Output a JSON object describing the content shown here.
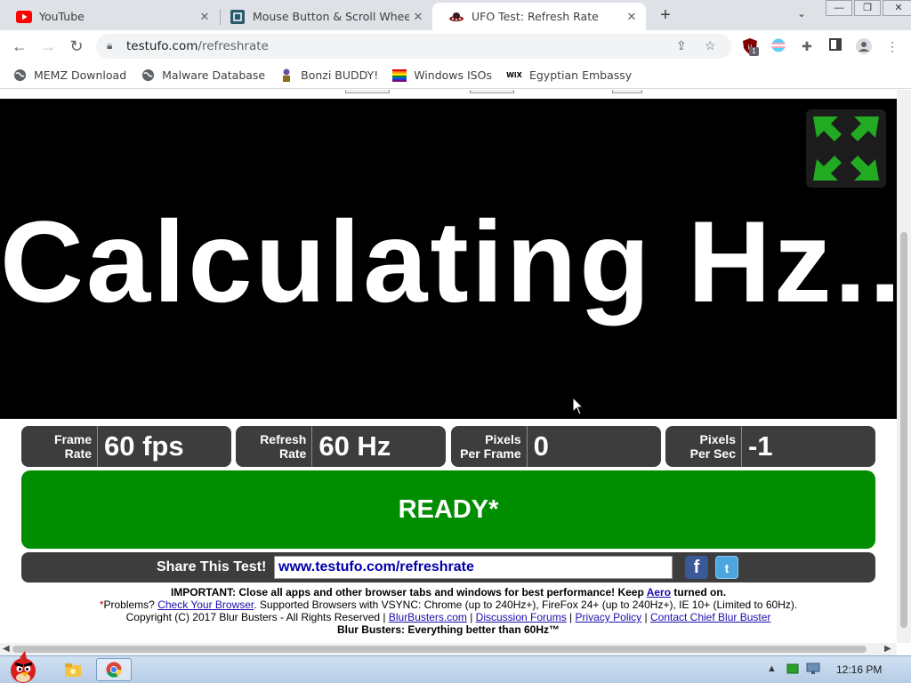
{
  "browser": {
    "tabs": [
      {
        "title": "YouTube",
        "close": "✕"
      },
      {
        "title": "Mouse Button & Scroll Wheel",
        "close": "✕"
      },
      {
        "title": "UFO Test: Refresh Rate",
        "close": "✕"
      }
    ],
    "new_tab": "+",
    "tab_search": "⌄",
    "window_controls": {
      "minimize": "—",
      "restore": "❐",
      "close": "✕"
    },
    "url_host": "testufo.com",
    "url_path": "/refreshrate",
    "extension_badge": "1",
    "bookmarks": [
      {
        "label": "MEMZ Download",
        "icon": "globe-icon"
      },
      {
        "label": "Malware Database",
        "icon": "globe-icon"
      },
      {
        "label": "Bonzi BUDDY!",
        "icon": "bonzi-icon"
      },
      {
        "label": "Windows ISOs",
        "icon": "rainbow-flag-icon"
      },
      {
        "label": "Egyptian Embassy",
        "icon": "wix-icon"
      }
    ],
    "wix_text": "WiX"
  },
  "page": {
    "stage_text": "Calculating Hz...",
    "stats": [
      {
        "label1": "Frame",
        "label2": "Rate",
        "value": "60 fps"
      },
      {
        "label1": "Refresh",
        "label2": "Rate",
        "value": "60 Hz"
      },
      {
        "label1": "Pixels",
        "label2": "Per Frame",
        "value": "0"
      },
      {
        "label1": "Pixels",
        "label2": "Per Sec",
        "value": "-1"
      }
    ],
    "ready": "READY*",
    "share_label": "Share This Test!",
    "share_url": "www.testufo.com/refreshrate",
    "facebook": "f",
    "twitter": "t",
    "footer": {
      "important_prefix": "IMPORTANT: Close all apps and other browser tabs and windows for best performance! Keep ",
      "aero": "Aero",
      "important_suffix": " turned on.",
      "problems_star": "*",
      "problems_prefix": "Problems? ",
      "check_browser": "Check Your Browser",
      "problems_suffix": ". Supported Browsers with VSYNC: Chrome (up to 240Hz+), FireFox 24+ (up to 240Hz+), IE 10+ (Limited to 60Hz).",
      "copyright": "Copyright (C) 2017 Blur Busters - All Rights Reserved | ",
      "link_blurbusters": "BlurBusters.com",
      "sep": " | ",
      "link_forums": "Discussion Forums",
      "link_privacy": "Privacy Policy",
      "link_contact": "Contact Chief Blur Buster",
      "tagline": "Blur Busters: Everything better than 60Hz™"
    }
  },
  "taskbar": {
    "clock": "12:16 PM",
    "tray_arrow": "▲"
  },
  "colors": {
    "ready_green": "#008d00",
    "stat_bg": "#3d3d3d",
    "stage_bg": "#000000",
    "fullscreen_arrows": "#22aa22"
  }
}
